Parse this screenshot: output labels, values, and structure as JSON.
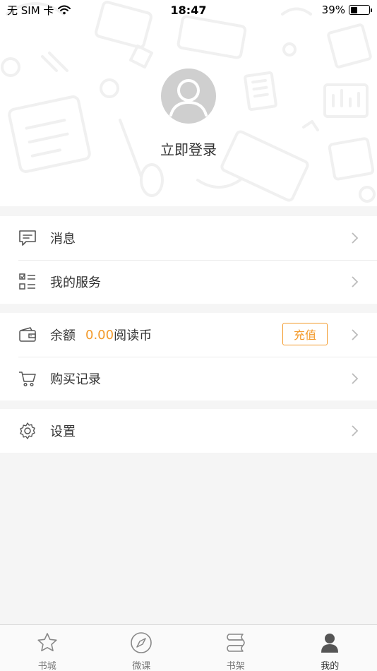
{
  "status_bar": {
    "carrier": "无 SIM 卡",
    "time": "18:47",
    "battery_text": "39%",
    "battery_level": 0.39
  },
  "profile": {
    "login_label": "立即登录"
  },
  "menu": {
    "messages": {
      "label": "消息",
      "icon": "message-icon"
    },
    "services": {
      "label": "我的服务",
      "icon": "checklist-icon"
    },
    "balance": {
      "label": "余额",
      "amount": "0.00",
      "unit": "阅读币",
      "recharge_label": "充值",
      "icon": "wallet-icon"
    },
    "purchases": {
      "label": "购买记录",
      "icon": "cart-icon"
    },
    "settings": {
      "label": "设置",
      "icon": "gear-icon"
    }
  },
  "tabbar": {
    "items": [
      {
        "label": "书城",
        "icon": "star-icon",
        "active": false
      },
      {
        "label": "微课",
        "icon": "compass-icon",
        "active": false
      },
      {
        "label": "书架",
        "icon": "bookshelf-icon",
        "active": false
      },
      {
        "label": "我的",
        "icon": "person-icon",
        "active": true
      }
    ]
  },
  "colors": {
    "accent": "#f39a2b",
    "text": "#333333",
    "background": "#f5f5f5"
  }
}
